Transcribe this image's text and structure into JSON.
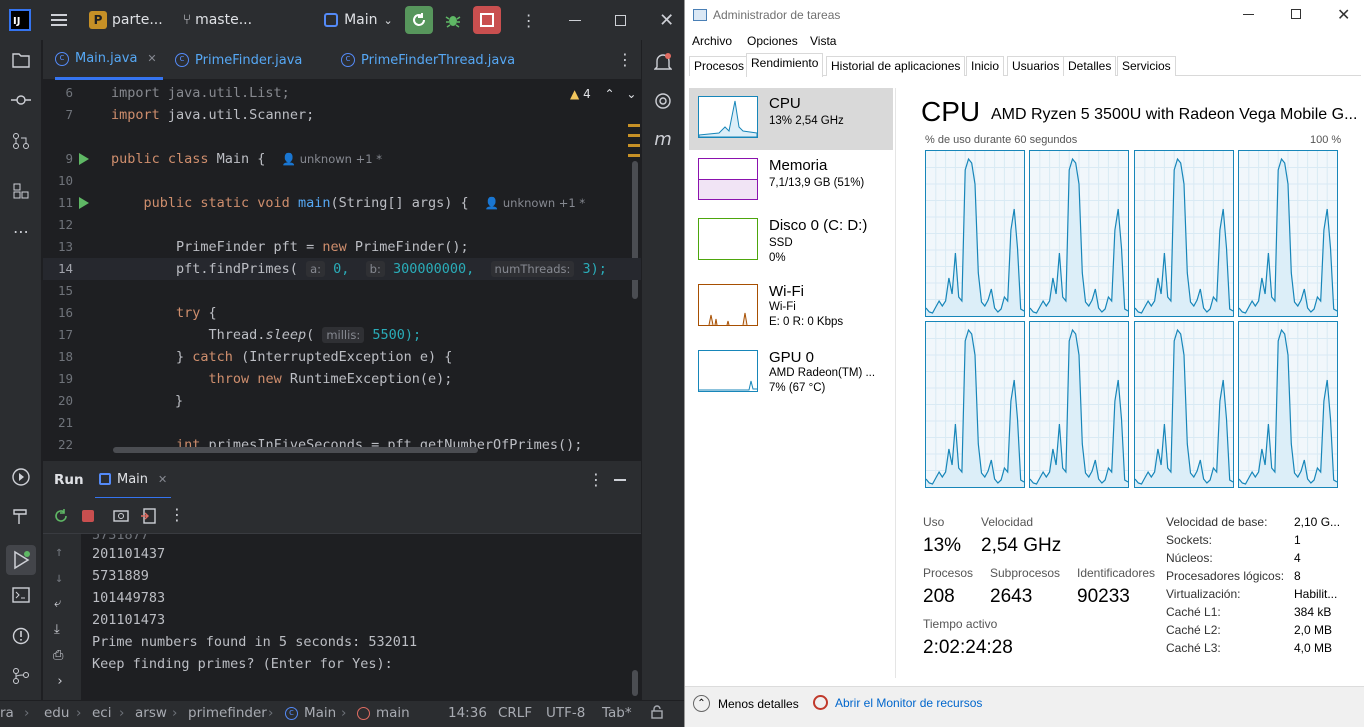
{
  "ide": {
    "project": {
      "badge": "P",
      "name": "parte..."
    },
    "branch": "maste...",
    "run_config": "Main",
    "tabs": [
      {
        "label": "Main.java",
        "active": true
      },
      {
        "label": "PrimeFinder.java",
        "active": false
      },
      {
        "label": "PrimeFinderThread.java",
        "active": false
      }
    ],
    "warnings": "4",
    "code_lines": [
      {
        "n": "6",
        "text": "import java.util.List;"
      },
      {
        "n": "7",
        "text": "import java.util.Scanner;"
      },
      {
        "n": "9",
        "text": "public class Main {"
      },
      {
        "n": "10",
        "text": ""
      },
      {
        "n": "11",
        "text": "public static void main(String[] args) {"
      },
      {
        "n": "12",
        "text": ""
      },
      {
        "n": "13",
        "text": "PrimeFinder pft = new PrimeFinder();"
      },
      {
        "n": "14",
        "text": "pft.findPrimes("
      },
      {
        "n": "15",
        "text": ""
      },
      {
        "n": "16",
        "text": "try {"
      },
      {
        "n": "17",
        "text": "Thread.sleep("
      },
      {
        "n": "18",
        "text": "} catch (InterruptedException e) {"
      },
      {
        "n": "19",
        "text": "throw new RuntimeException(e);"
      },
      {
        "n": "20",
        "text": "}"
      },
      {
        "n": "21",
        "text": ""
      },
      {
        "n": "22",
        "text": "int primesInFiveSeconds = pft.getNumberOfPrimes();"
      }
    ],
    "author_hint": "unknown +1 *",
    "params": {
      "a": "a:",
      "a_val": "0,",
      "b": "b:",
      "b_val": "300000000,",
      "threads": "numThreads:",
      "threads_val": "3);",
      "millis": "millis:",
      "millis_val": "5500);"
    },
    "run_panel": {
      "title": "Run",
      "tab": "Main"
    },
    "console_lines": [
      "201101437",
      "5731889",
      "101449783",
      "201101473",
      "Prime numbers found in 5 seconds: 532011",
      "Keep finding primes? (Enter for Yes):"
    ],
    "breadcrumb": [
      "ra",
      "edu",
      "eci",
      "arsw",
      "primefinder",
      "Main",
      "main"
    ],
    "status": {
      "pos": "14:36",
      "eol": "CRLF",
      "enc": "UTF-8",
      "indent": "Tab*"
    }
  },
  "tm": {
    "title": "Administrador de tareas",
    "menu": [
      "Archivo",
      "Opciones",
      "Vista"
    ],
    "tabs": [
      "Procesos",
      "Rendimiento",
      "Historial de aplicaciones",
      "Inicio",
      "Usuarios",
      "Detalles",
      "Servicios"
    ],
    "active_tab": "Rendimiento",
    "side": [
      {
        "title": "CPU",
        "l1": "13%  2,54 GHz",
        "l2": "",
        "color": "#1786b9"
      },
      {
        "title": "Memoria",
        "l1": "7,1/13,9 GB (51%)",
        "l2": "",
        "color": "#8b12ae"
      },
      {
        "title": "Disco 0 (C: D:)",
        "l1": "SSD",
        "l2": "0%",
        "color": "#4da60c"
      },
      {
        "title": "Wi-Fi",
        "l1": "Wi-Fi",
        "l2": "E: 0  R: 0 Kbps",
        "color": "#a74f01"
      },
      {
        "title": "GPU 0",
        "l1": "AMD Radeon(TM) ...",
        "l2": "7% (67 °C)",
        "color": "#1786b9"
      }
    ],
    "heading": "CPU",
    "cpu_name": "AMD Ryzen 5 3500U with Radeon Vega Mobile G...",
    "graph_label": "% de uso durante 60 segundos",
    "graph_max": "100 %",
    "stats": {
      "uso_l": "Uso",
      "uso_v": "13%",
      "vel_l": "Velocidad",
      "vel_v": "2,54 GHz",
      "proc_l": "Procesos",
      "proc_v": "208",
      "sub_l": "Subprocesos",
      "sub_v": "2643",
      "id_l": "Identificadores",
      "id_v": "90233",
      "up_l": "Tiempo activo",
      "up_v": "2:02:24:28"
    },
    "right": [
      {
        "k": "Velocidad de base:",
        "v": "2,10 G..."
      },
      {
        "k": "Sockets:",
        "v": "1"
      },
      {
        "k": "Núcleos:",
        "v": "4"
      },
      {
        "k": "Procesadores lógicos:",
        "v": "8"
      },
      {
        "k": "Virtualización:",
        "v": "Habilit..."
      },
      {
        "k": "Caché L1:",
        "v": "384 kB"
      },
      {
        "k": "Caché L2:",
        "v": "2,0 MB"
      },
      {
        "k": "Caché L3:",
        "v": "4,0 MB"
      }
    ],
    "footer": {
      "less": "Menos detalles",
      "monitor": "Abrir el Monitor de recursos"
    }
  }
}
